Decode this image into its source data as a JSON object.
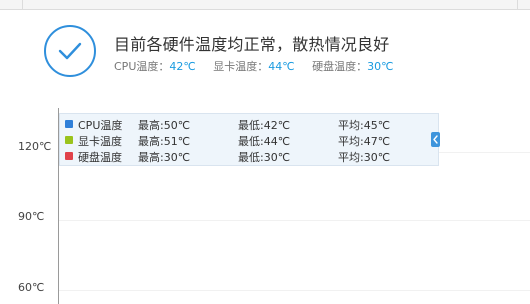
{
  "status": {
    "title": "目前各硬件温度均正常，散热情况良好",
    "icon": "checkmark-circle-icon",
    "accent_color": "#2f8fdc",
    "temps": [
      {
        "label": "CPU温度：",
        "value": "42℃"
      },
      {
        "label": "显卡温度：",
        "value": "44℃"
      },
      {
        "label": "硬盘温度：",
        "value": "30℃"
      }
    ]
  },
  "chart": {
    "y_ticks": [
      "120℃",
      "90℃",
      "60℃"
    ],
    "legend": [
      {
        "name": "CPU温度",
        "color": "#2f7fd8",
        "max": "最高:50℃",
        "min": "最低:42℃",
        "avg": "平均:45℃"
      },
      {
        "name": "显卡温度",
        "color": "#9ac31c",
        "max": "最高:51℃",
        "min": "最低:44℃",
        "avg": "平均:47℃"
      },
      {
        "name": "硬盘温度",
        "color": "#e0424a",
        "max": "最高:30℃",
        "min": "最低:30℃",
        "avg": "平均:30℃"
      }
    ],
    "collapse_icon": "chevron-left-icon"
  },
  "chart_data": {
    "type": "line",
    "title": "",
    "xlabel": "",
    "ylabel": "",
    "y_tick_labels": [
      "120℃",
      "90℃",
      "60℃"
    ],
    "series": [
      {
        "name": "CPU温度",
        "max": 50,
        "min": 42,
        "avg": 45
      },
      {
        "name": "显卡温度",
        "max": 51,
        "min": 44,
        "avg": 47
      },
      {
        "name": "硬盘温度",
        "max": 30,
        "min": 30,
        "avg": 30
      }
    ],
    "legend_placement": "top-left"
  }
}
